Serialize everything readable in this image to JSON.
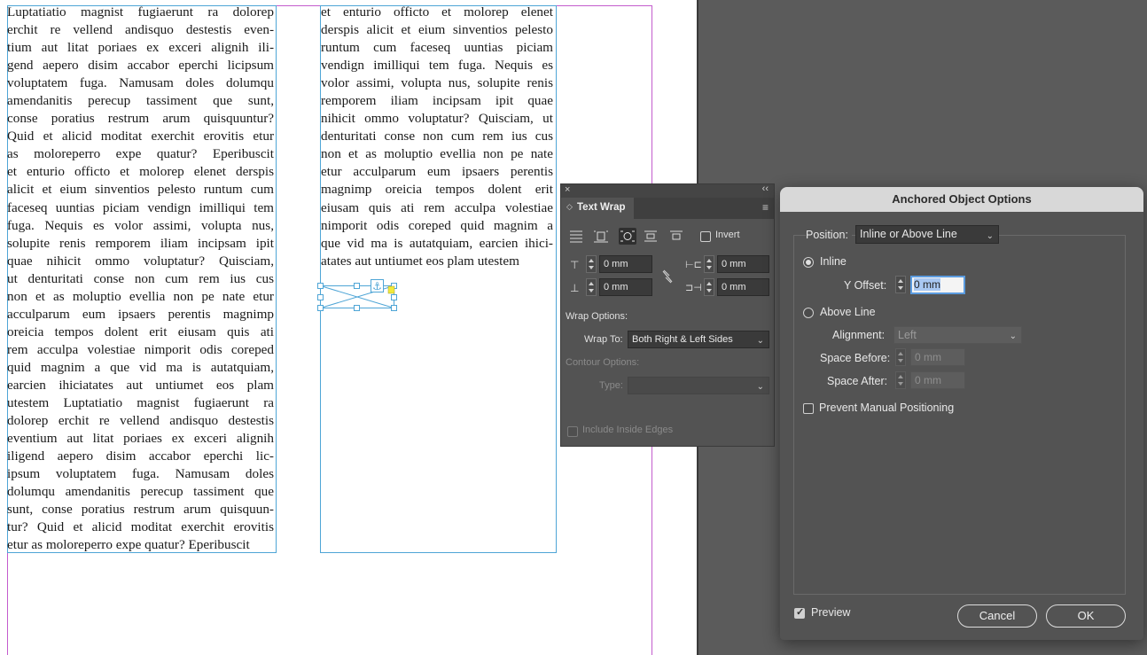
{
  "document": {
    "column1": [
      "Luptatiatio magnist fugiaerunt ra dolorep",
      "erchit re vellend andisquo destestis even-",
      "tium aut litat poriaes ex exceri alignih ili-",
      "gend aepero disim accabor eperchi licipsum",
      "voluptatem fuga. Namusam doles dolumqu",
      "amendanitis perecup tassiment que sunt,",
      "conse poratius restrum arum quisquuntur?",
      "Quid et alicid moditat exerchit erovitis etur",
      "as moloreperro expe quatur? Eperibuscit",
      "et enturio officto et molorep elenet derspis",
      "alicit et eium sinventios pelesto runtum cum",
      "faceseq uuntias piciam vendign imilliqui tem",
      "fuga. Nequis es volor assimi, volupta nus,",
      "solupite renis remporem iliam incipsam ipit",
      "quae nihicit ommo voluptatur? Quisciam,",
      "ut denturitati conse non cum rem ius cus",
      "non et as moluptio evellia non pe nate etur",
      "acculparum eum ipsaers perentis magnimp",
      "oreicia tempos dolent erit eiusam quis ati",
      "rem acculpa volestiae nimporit odis coreped",
      "quid magnim a que vid ma is autatquiam,",
      "earcien ihiciatates aut untiumet eos plam",
      "utestem Luptatiatio magnist fugiaerunt ra",
      "dolorep erchit re vellend andisquo destestis",
      "eventium aut litat poriaes ex exceri alignih",
      "iligend aepero disim accabor eperchi lic-",
      "ipsum voluptatem fuga. Namusam doles",
      "dolumqu amendanitis perecup tassiment que",
      "sunt, conse poratius restrum arum quisquun-",
      "tur? Quid et alicid moditat exerchit erovitis",
      "etur as moloreperro expe quatur? Eperibuscit"
    ],
    "column2": [
      "et enturio officto et molorep elenet",
      "derspis alicit et eium sinventios pelesto",
      "runtum cum faceseq uuntias piciam",
      "vendign imilliqui tem fuga. Nequis es",
      "volor assimi, volupta nus, solupite renis",
      "remporem iliam incipsam ipit quae",
      "nihicit ommo voluptatur? Quisciam, ut",
      "denturitati conse non cum rem ius cus",
      "non et as moluptio evellia non pe nate",
      "etur acculparum eum ipsaers perentis",
      "magnimp oreicia tempos dolent erit",
      "eiusam quis ati rem acculpa volestiae",
      "nimporit odis coreped quid magnim a",
      "que vid ma is autatquiam, earcien ihici-",
      "atates aut untiumet eos plam utestem"
    ]
  },
  "text_wrap_panel": {
    "title": "Text Wrap",
    "invert_label": "Invert",
    "top_offset": "0 mm",
    "bottom_offset": "0 mm",
    "left_offset": "0 mm",
    "right_offset": "0 mm",
    "wrap_options_label": "Wrap Options:",
    "wrap_to_label": "Wrap To:",
    "wrap_to_value": "Both Right & Left Sides",
    "contour_options_label": "Contour Options:",
    "type_label": "Type:",
    "type_value": "",
    "include_inside_edges_label": "Include Inside Edges"
  },
  "anchored_dialog": {
    "title": "Anchored Object Options",
    "position_label": "Position:",
    "position_value": "Inline or Above Line",
    "inline_label": "Inline",
    "y_offset_label": "Y Offset:",
    "y_offset_value": "0 mm",
    "above_line_label": "Above Line",
    "alignment_label": "Alignment:",
    "alignment_value": "Left",
    "space_before_label": "Space Before:",
    "space_before_value": "0 mm",
    "space_after_label": "Space After:",
    "space_after_value": "0 mm",
    "prevent_label": "Prevent Manual Positioning",
    "preview_label": "Preview",
    "cancel_label": "Cancel",
    "ok_label": "OK"
  },
  "colors": {
    "frame_guide": "#4ea5d6",
    "margin_guide": "#c35ccd",
    "panel_bg": "#535353",
    "pasteboard": "#5b5b5b"
  }
}
